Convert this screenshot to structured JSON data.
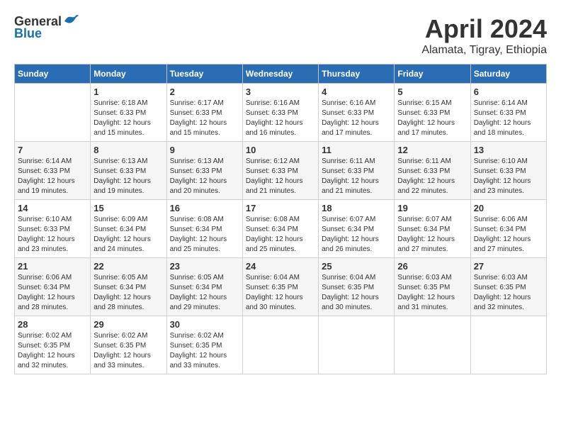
{
  "header": {
    "logo_general": "General",
    "logo_blue": "Blue",
    "month": "April 2024",
    "location": "Alamata, Tigray, Ethiopia"
  },
  "calendar": {
    "days_of_week": [
      "Sunday",
      "Monday",
      "Tuesday",
      "Wednesday",
      "Thursday",
      "Friday",
      "Saturday"
    ],
    "weeks": [
      [
        {
          "day": "",
          "info": ""
        },
        {
          "day": "1",
          "info": "Sunrise: 6:18 AM\nSunset: 6:33 PM\nDaylight: 12 hours\nand 15 minutes."
        },
        {
          "day": "2",
          "info": "Sunrise: 6:17 AM\nSunset: 6:33 PM\nDaylight: 12 hours\nand 15 minutes."
        },
        {
          "day": "3",
          "info": "Sunrise: 6:16 AM\nSunset: 6:33 PM\nDaylight: 12 hours\nand 16 minutes."
        },
        {
          "day": "4",
          "info": "Sunrise: 6:16 AM\nSunset: 6:33 PM\nDaylight: 12 hours\nand 17 minutes."
        },
        {
          "day": "5",
          "info": "Sunrise: 6:15 AM\nSunset: 6:33 PM\nDaylight: 12 hours\nand 17 minutes."
        },
        {
          "day": "6",
          "info": "Sunrise: 6:14 AM\nSunset: 6:33 PM\nDaylight: 12 hours\nand 18 minutes."
        }
      ],
      [
        {
          "day": "7",
          "info": "Sunrise: 6:14 AM\nSunset: 6:33 PM\nDaylight: 12 hours\nand 19 minutes."
        },
        {
          "day": "8",
          "info": "Sunrise: 6:13 AM\nSunset: 6:33 PM\nDaylight: 12 hours\nand 19 minutes."
        },
        {
          "day": "9",
          "info": "Sunrise: 6:13 AM\nSunset: 6:33 PM\nDaylight: 12 hours\nand 20 minutes."
        },
        {
          "day": "10",
          "info": "Sunrise: 6:12 AM\nSunset: 6:33 PM\nDaylight: 12 hours\nand 21 minutes."
        },
        {
          "day": "11",
          "info": "Sunrise: 6:11 AM\nSunset: 6:33 PM\nDaylight: 12 hours\nand 21 minutes."
        },
        {
          "day": "12",
          "info": "Sunrise: 6:11 AM\nSunset: 6:33 PM\nDaylight: 12 hours\nand 22 minutes."
        },
        {
          "day": "13",
          "info": "Sunrise: 6:10 AM\nSunset: 6:33 PM\nDaylight: 12 hours\nand 23 minutes."
        }
      ],
      [
        {
          "day": "14",
          "info": "Sunrise: 6:10 AM\nSunset: 6:33 PM\nDaylight: 12 hours\nand 23 minutes."
        },
        {
          "day": "15",
          "info": "Sunrise: 6:09 AM\nSunset: 6:34 PM\nDaylight: 12 hours\nand 24 minutes."
        },
        {
          "day": "16",
          "info": "Sunrise: 6:08 AM\nSunset: 6:34 PM\nDaylight: 12 hours\nand 25 minutes."
        },
        {
          "day": "17",
          "info": "Sunrise: 6:08 AM\nSunset: 6:34 PM\nDaylight: 12 hours\nand 25 minutes."
        },
        {
          "day": "18",
          "info": "Sunrise: 6:07 AM\nSunset: 6:34 PM\nDaylight: 12 hours\nand 26 minutes."
        },
        {
          "day": "19",
          "info": "Sunrise: 6:07 AM\nSunset: 6:34 PM\nDaylight: 12 hours\nand 27 minutes."
        },
        {
          "day": "20",
          "info": "Sunrise: 6:06 AM\nSunset: 6:34 PM\nDaylight: 12 hours\nand 27 minutes."
        }
      ],
      [
        {
          "day": "21",
          "info": "Sunrise: 6:06 AM\nSunset: 6:34 PM\nDaylight: 12 hours\nand 28 minutes."
        },
        {
          "day": "22",
          "info": "Sunrise: 6:05 AM\nSunset: 6:34 PM\nDaylight: 12 hours\nand 28 minutes."
        },
        {
          "day": "23",
          "info": "Sunrise: 6:05 AM\nSunset: 6:34 PM\nDaylight: 12 hours\nand 29 minutes."
        },
        {
          "day": "24",
          "info": "Sunrise: 6:04 AM\nSunset: 6:35 PM\nDaylight: 12 hours\nand 30 minutes."
        },
        {
          "day": "25",
          "info": "Sunrise: 6:04 AM\nSunset: 6:35 PM\nDaylight: 12 hours\nand 30 minutes."
        },
        {
          "day": "26",
          "info": "Sunrise: 6:03 AM\nSunset: 6:35 PM\nDaylight: 12 hours\nand 31 minutes."
        },
        {
          "day": "27",
          "info": "Sunrise: 6:03 AM\nSunset: 6:35 PM\nDaylight: 12 hours\nand 32 minutes."
        }
      ],
      [
        {
          "day": "28",
          "info": "Sunrise: 6:02 AM\nSunset: 6:35 PM\nDaylight: 12 hours\nand 32 minutes."
        },
        {
          "day": "29",
          "info": "Sunrise: 6:02 AM\nSunset: 6:35 PM\nDaylight: 12 hours\nand 33 minutes."
        },
        {
          "day": "30",
          "info": "Sunrise: 6:02 AM\nSunset: 6:35 PM\nDaylight: 12 hours\nand 33 minutes."
        },
        {
          "day": "",
          "info": ""
        },
        {
          "day": "",
          "info": ""
        },
        {
          "day": "",
          "info": ""
        },
        {
          "day": "",
          "info": ""
        }
      ]
    ]
  }
}
